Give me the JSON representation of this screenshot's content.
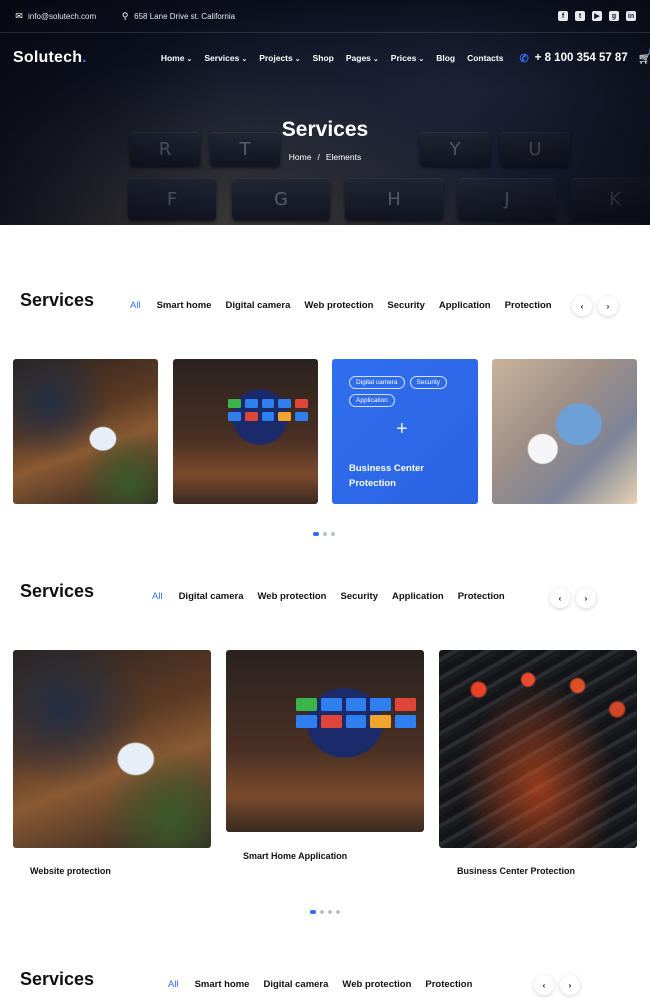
{
  "topbar": {
    "email": "info@solutech.com",
    "address": "658 Lane Drive st. California",
    "socials": [
      {
        "name": "facebook-icon",
        "glyph": "f"
      },
      {
        "name": "twitter-icon",
        "glyph": "t"
      },
      {
        "name": "youtube-icon",
        "glyph": "▶"
      },
      {
        "name": "github-icon",
        "glyph": "g"
      },
      {
        "name": "linkedin-icon",
        "glyph": "in"
      }
    ]
  },
  "nav": {
    "logo": "Solutech",
    "logo_dot": ".",
    "menu": [
      "Home",
      "Services",
      "Projects",
      "Shop",
      "Pages",
      "Prices",
      "Blog",
      "Contacts"
    ],
    "phone": "+ 8 100 354 57 87",
    "cart_count": "0"
  },
  "hero": {
    "title": "Services",
    "breadcrumb": [
      "Home",
      "Elements"
    ],
    "keys": [
      "F",
      "G",
      "H",
      "J",
      "K",
      "R",
      "T",
      "Y",
      "U"
    ]
  },
  "section1": {
    "title": "Services",
    "filters": [
      "All",
      "Smart home",
      "Digital camera",
      "Web protection",
      "Security",
      "Application",
      "Protection"
    ],
    "blue_card": {
      "tags": [
        "Digital camera",
        "Security",
        "Application"
      ],
      "title": "Business Center Protection"
    }
  },
  "section2": {
    "title": "Services",
    "filters": [
      "All",
      "Digital camera",
      "Web protection",
      "Security",
      "Application",
      "Protection"
    ],
    "captions": [
      "Website protection",
      "Smart Home Application",
      "Business Center Protection"
    ]
  },
  "section3": {
    "title": "Services",
    "filters": [
      "All",
      "Smart home",
      "Digital camera",
      "Web protection",
      "Protection"
    ]
  },
  "arrows": {
    "prev": "‹",
    "next": "›"
  },
  "colors": {
    "accent": "#2f6ff0",
    "hero_bg": "#141a2c"
  }
}
